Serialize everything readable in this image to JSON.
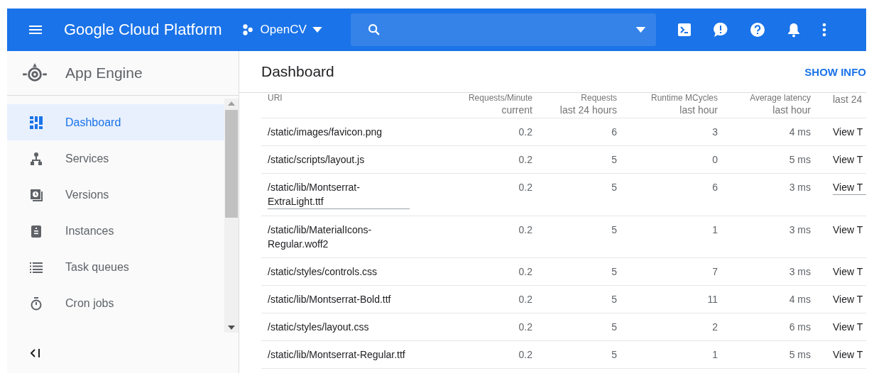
{
  "topbar": {
    "product": "Google Cloud Platform",
    "project": "OpenCV"
  },
  "sidebar": {
    "title": "App Engine",
    "items": [
      {
        "label": "Dashboard",
        "selected": true
      },
      {
        "label": "Services",
        "selected": false
      },
      {
        "label": "Versions",
        "selected": false
      },
      {
        "label": "Instances",
        "selected": false
      },
      {
        "label": "Task queues",
        "selected": false
      },
      {
        "label": "Cron jobs",
        "selected": false
      }
    ]
  },
  "page": {
    "title": "Dashboard",
    "action": "SHOW INFO"
  },
  "table": {
    "columns": [
      {
        "title": "URI"
      },
      {
        "title": "Requests/Minute",
        "subtitle": "current"
      },
      {
        "title": "Requests",
        "subtitle": "last 24 hours"
      },
      {
        "title": "Runtime MCycles",
        "subtitle": "last hour"
      },
      {
        "title": "Average latency",
        "subtitle": "last hour"
      },
      {
        "subtitle": "last 24"
      }
    ],
    "rows": [
      {
        "hovered": false,
        "cells": [
          "/static/images/favicon.png",
          "0.2",
          "6",
          "3",
          "4 ms",
          "View T"
        ]
      },
      {
        "hovered": false,
        "cells": [
          "/static/scripts/layout.js",
          "0.2",
          "5",
          "0",
          "5 ms",
          "View T"
        ]
      },
      {
        "hovered": true,
        "cells": [
          "/static/lib/Montserrat-ExtraLight.ttf",
          "0.2",
          "5",
          "6",
          "3 ms",
          "View T"
        ]
      },
      {
        "hovered": false,
        "cells": [
          "/static/lib/MaterialIcons-Regular.woff2",
          "0.2",
          "5",
          "1",
          "3 ms",
          "View T"
        ]
      },
      {
        "hovered": false,
        "cells": [
          "/static/styles/controls.css",
          "0.2",
          "5",
          "7",
          "3 ms",
          "View T"
        ]
      },
      {
        "hovered": false,
        "cells": [
          "/static/lib/Montserrat-Bold.ttf",
          "0.2",
          "5",
          "11",
          "4 ms",
          "View T"
        ]
      },
      {
        "hovered": false,
        "cells": [
          "/static/styles/layout.css",
          "0.2",
          "5",
          "2",
          "6 ms",
          "View T"
        ]
      },
      {
        "hovered": false,
        "cells": [
          "/static/lib/Montserrat-Regular.ttf",
          "0.2",
          "5",
          "1",
          "5 ms",
          "View T"
        ]
      }
    ]
  }
}
